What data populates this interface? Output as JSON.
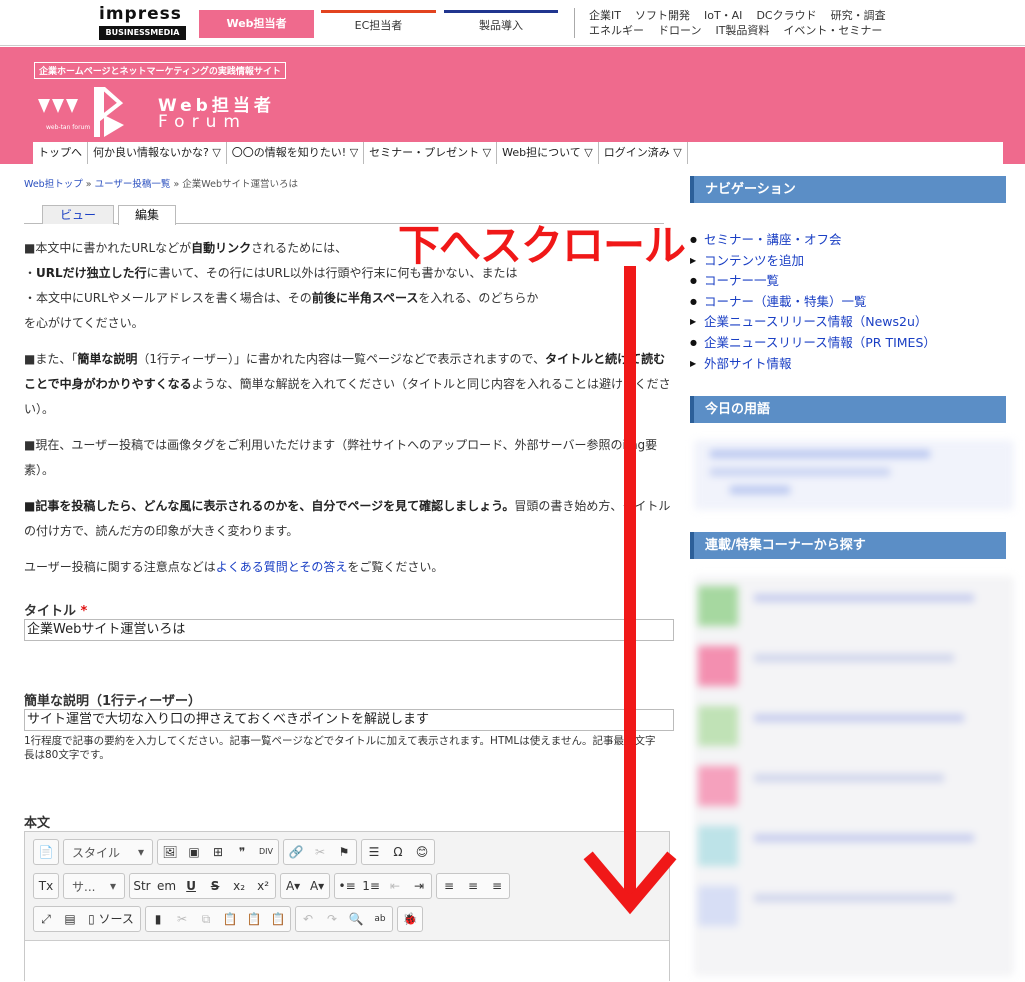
{
  "header": {
    "logo_top": "impress",
    "logo_bottom": "BUSINESSMEDIA",
    "site_tabs": [
      "Web担当者",
      "EC担当者",
      "製品導入"
    ],
    "category_links_row1": [
      "企業IT",
      "ソフト開発",
      "IoT・AI",
      "DCクラウド",
      "研究・調査"
    ],
    "category_links_row2": [
      "エネルギー",
      "ドローン",
      "IT製品資料",
      "イベント・セミナー"
    ]
  },
  "banner": {
    "tagline": "企業ホームページとネットマーケティングの実践情報サイト",
    "brand_line1": "Web担当者",
    "brand_line2": "Forum",
    "mark_text": "web-tan forum",
    "main_nav": [
      "トップへ",
      "何か良い情報ないかな? ▽",
      "〇〇の情報を知りたい! ▽",
      "セミナー・プレゼント ▽",
      "Web担について ▽",
      "ログイン済み ▽"
    ]
  },
  "breadcrumb": {
    "home": "Web担トップ",
    "sep": "»",
    "list": "ユーザー投稿一覧",
    "current": "企業Webサイト運営いろは"
  },
  "view_tabs": {
    "view": "ビュー",
    "edit": "編集"
  },
  "instructions": {
    "p1_a": "■本文中に書かれたURLなどが",
    "p1_b": "自動リンク",
    "p1_c": "されるためには、",
    "p1_d": "・",
    "p1_e": "URLだけ独立した行",
    "p1_f": "に書いて、その行にはURL以外は行頭や行末に何も書かない、または",
    "p1_g": "・本文中にURLやメールアドレスを書く場合は、その",
    "p1_h": "前後に半角スペース",
    "p1_i": "を入れる、のどちらか",
    "p1_j": "を心がけてください。",
    "p2_a": "■また、「",
    "p2_b": "簡単な説明",
    "p2_c": "（1行ティーザー）」に書かれた内容は一覧ページなどで表示されますので、",
    "p2_d": "タイトルと続けて読むことで中身がわかりやすくなる",
    "p2_e": "ような、簡単な解説を入れてください（タイトルと同じ内容を入れることは避けてください）。",
    "p3": "■現在、ユーザー投稿では画像タグをご利用いただけます（弊社サイトへのアップロード、外部サーバー参照のimg要素）。",
    "p4_a": "■記事を投稿したら、どんな風に表示されるのかを、自分でページを見て確認しましょう。",
    "p4_b": "冒頭の書き始め方、タイトルの付け方で、読んだ方の印象が大きく変わります。",
    "p5_a": "ユーザー投稿に関する注意点などは",
    "p5_link": "よくある質問とその答え",
    "p5_b": "をご覧ください。"
  },
  "form": {
    "title_label": "タイトル",
    "required_mark": "*",
    "title_value": "企業Webサイト運営いろは",
    "teaser_label": "簡単な説明（1行ティーザー）",
    "teaser_value": "サイト運営で大切な入り口の押さえておくべきポイントを解説します",
    "teaser_help": "1行程度で記事の要約を入力してください。記事一覧ページなどでタイトルに加えて表示されます。HTMLは使えません。記事最大文字長は80文字です。",
    "body_label": "本文"
  },
  "editor_toolbar": {
    "style_combo": "スタイル",
    "size_combo": "サ...",
    "source_label": "ソース",
    "row1": [
      "📄",
      "🖼",
      "▣",
      "⊞",
      "❞",
      "DIV",
      "🔗",
      "✂",
      "⚑",
      "☰",
      "Ω",
      "😊"
    ],
    "row2": [
      "Tx",
      "Str",
      "em",
      "U",
      "S",
      "x₂",
      "x²",
      "A▾",
      "A▾",
      "•≡",
      "1≡",
      "⇤",
      "⇥",
      "≡",
      "≡",
      "≡"
    ],
    "row3": [
      "⤢",
      "▤",
      "▯",
      "▮",
      "✂",
      "⧉",
      "📋",
      "📋",
      "📋",
      "↶",
      "↷",
      "🔍",
      "ab",
      "🐞"
    ]
  },
  "sidebar": {
    "nav_heading": "ナビゲーション",
    "nav_items": [
      {
        "bullet": "●",
        "label": "セミナー・講座・オフ会"
      },
      {
        "bullet": "▶",
        "label": "コンテンツを追加"
      },
      {
        "bullet": "●",
        "label": "コーナー一覧"
      },
      {
        "bullet": "●",
        "label": "コーナー（連載・特集）一覧"
      },
      {
        "bullet": "▶",
        "label": "企業ニュースリリース情報（News2u）"
      },
      {
        "bullet": "●",
        "label": "企業ニュースリリース情報（PR TIMES）"
      },
      {
        "bullet": "▶",
        "label": "外部サイト情報"
      }
    ],
    "term_heading": "今日の用語",
    "series_heading": "連載/特集コーナーから探す"
  },
  "overlay": {
    "scroll_hint": "下へスクロール",
    "color": "#f01818"
  },
  "colors": {
    "brand_pink": "#ef6a8d",
    "sidebar_blue": "#5b8ec6",
    "link": "#1a3fc4"
  }
}
